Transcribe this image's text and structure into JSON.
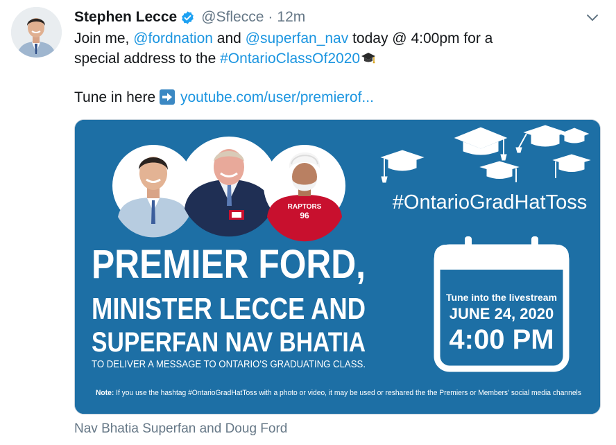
{
  "tweet": {
    "author_name": "Stephen Lecce",
    "handle": "@Sflecce",
    "separator": "·",
    "time": "12m",
    "line1_pre": "Join me, ",
    "mention1": "@fordnation",
    "line1_mid": " and ",
    "mention2": "@superfan_nav",
    "line1_post": " today @ 4:00pm for a",
    "line2_pre": "special address to the ",
    "hashtag": "#OntarioClassOf2020",
    "tune_pre": "Tune in here ",
    "link_url": "youtube.com/user/premierof..."
  },
  "card": {
    "hashtag": "#OntarioGradHatToss",
    "headline1": "PREMIER FORD,",
    "headline2": "MINISTER LECCE AND",
    "headline3": "SUPERFAN NAV BHATIA",
    "subline": "TO DELIVER A MESSAGE TO ONTARIO'S GRADUATING CLASS.",
    "calendar_intro": "Tune into the livestream",
    "calendar_date": "JUNE 24, 2020",
    "calendar_time": "4:00 PM",
    "note_label": "Note:",
    "note_text": " If you use the hashtag #OntarioGradHatToss with a photo or video, it may be used or reshared the the Premiers or Members' social media channels",
    "jersey_word": "RAPTORS",
    "jersey_number": "96"
  },
  "caption": "Nav Bhatia Superfan and Doug Ford",
  "colors": {
    "card_bg": "#1d6fa5",
    "link": "#1b95e0",
    "muted": "#657786",
    "jersey_red": "#c8102e"
  },
  "icons": [
    "verified-badge-icon",
    "chevron-down-icon",
    "graduation-cap-icon",
    "right-arrow-icon",
    "calendar-icon"
  ]
}
